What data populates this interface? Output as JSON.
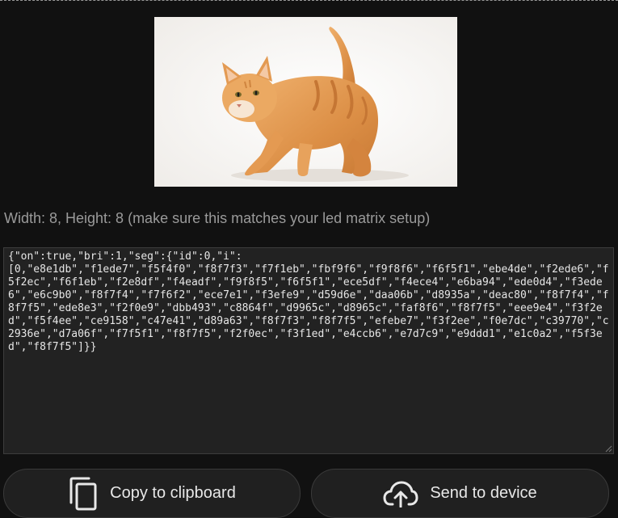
{
  "preview": {
    "subject": "orange tabby cat photo"
  },
  "dimensions_text": "Width: 8, Height: 8 (make sure this matches your led matrix setup)",
  "json_output": "{\"on\":true,\"bri\":1,\"seg\":{\"id\":0,\"i\":\n[0,\"e8e1db\",\"f1ede7\",\"f5f4f0\",\"f8f7f3\",\"f7f1eb\",\"fbf9f6\",\"f9f8f6\",\"f6f5f1\",\"ebe4de\",\"f2ede6\",\"f5f2ec\",\"f6f1eb\",\"f2e8df\",\"f4eadf\",\"f9f8f5\",\"f6f5f1\",\"ece5df\",\"f4ece4\",\"e6ba94\",\"ede0d4\",\"f3ede6\",\"e6c9b0\",\"f8f7f4\",\"f7f6f2\",\"ece7e1\",\"f3efe9\",\"d59d6e\",\"daa06b\",\"d8935a\",\"deac80\",\"f8f7f4\",\"f8f7f5\",\"ede8e3\",\"f2f0e9\",\"dbb493\",\"c8864f\",\"d9965c\",\"d8965c\",\"faf8f6\",\"f8f7f5\",\"eee9e4\",\"f3f2ed\",\"f5f4ee\",\"ce9158\",\"c47e41\",\"d89a63\",\"f8f7f3\",\"f8f7f5\",\"efebe7\",\"f3f2ee\",\"f0e7dc\",\"c39770\",\"c2936e\",\"d7a06f\",\"f7f5f1\",\"f8f7f5\",\"f2f0ec\",\"f3f1ed\",\"e4ccb6\",\"e7d7c9\",\"e9ddd1\",\"e1c0a2\",\"f5f3ed\",\"f8f7f5\"]}}",
  "buttons": {
    "copy_label": "Copy to clipboard",
    "send_label": "Send to device"
  },
  "icons": {
    "copy": "copy-icon",
    "send": "cloud-upload-icon"
  },
  "colors": {
    "background": "#111111",
    "panel": "#222222",
    "button_bg": "#202020",
    "text_muted": "#9a9a9a",
    "text": "#e8e8e8"
  }
}
